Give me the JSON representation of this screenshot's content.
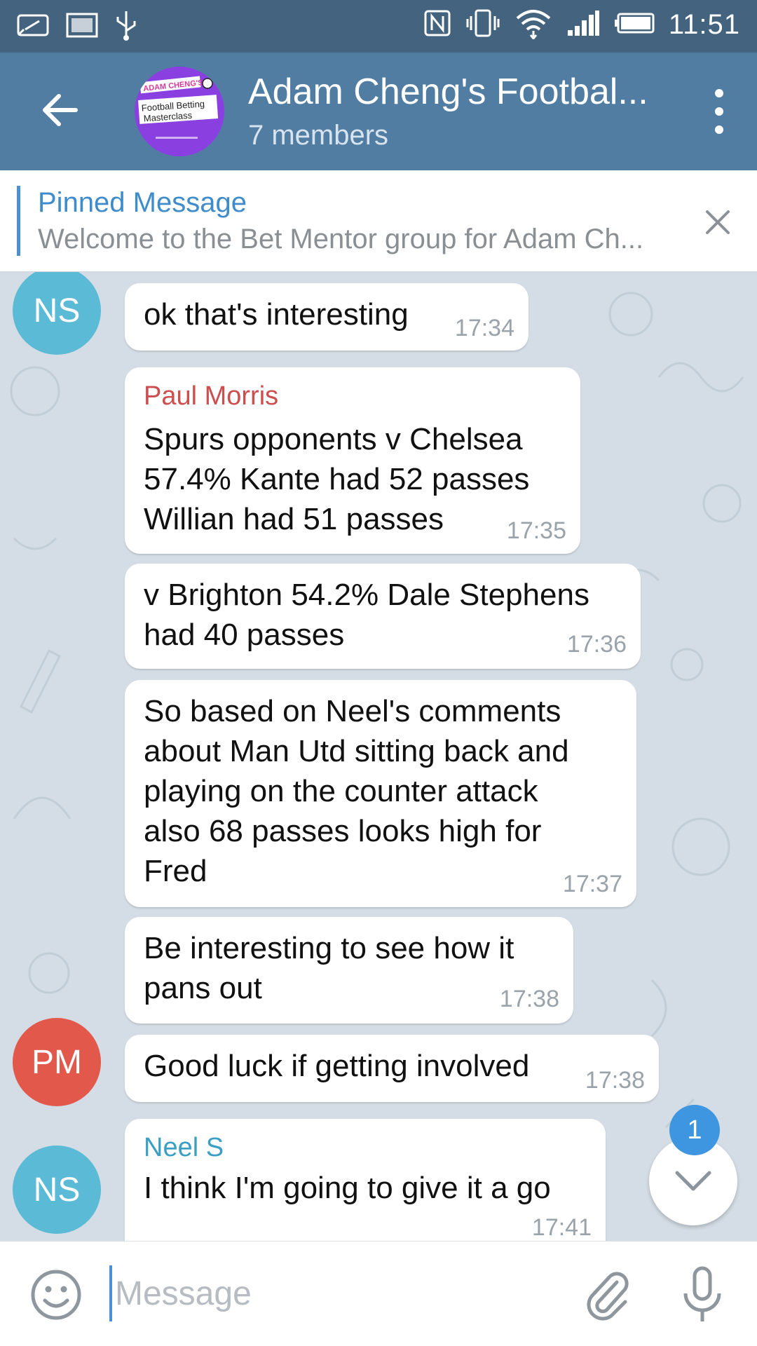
{
  "status_bar": {
    "time": "11:51",
    "left_icons": [
      "messaging-icon",
      "image-icon",
      "usb-icon"
    ],
    "right_icons": [
      "nfc-icon",
      "vibrate-icon",
      "wifi-icon",
      "signal-icon",
      "battery-icon"
    ]
  },
  "header": {
    "title": "Adam Cheng's Footbal...",
    "subtitle": "7 members",
    "avatar_lines": [
      "ADAM CHENG'S",
      "Football Betting",
      "Masterclass"
    ]
  },
  "pinned": {
    "label": "Pinned Message",
    "text": "Welcome to the Bet Mentor group for Adam Ch..."
  },
  "messages": [
    {
      "text": "ok that's interesting",
      "time": "17:34"
    },
    {
      "sender": "Paul Morris",
      "text": "Spurs opponents v Chelsea\n57.4% Kante had 52 passes\nWillian had 51 passes",
      "time": "17:35"
    },
    {
      "text": "v Brighton 54.2% Dale Stephens\nhad 40 passes",
      "time": "17:36"
    },
    {
      "text": "So based on Neel's comments\nabout Man Utd sitting back and\nplaying on the counter attack\nalso 68 passes looks high for\nFred",
      "time": "17:37"
    },
    {
      "text": "Be interesting to see how it\npans out",
      "time": "17:38"
    },
    {
      "text": "Good luck if getting involved",
      "time": "17:38"
    },
    {
      "sender": "Neel S",
      "text": "I think I'm going to give it a go",
      "time": "17:41"
    }
  ],
  "avatars": [
    {
      "initials": "NS",
      "color": "#5bbad5"
    },
    {
      "initials": "PM",
      "color": "#e2594b"
    },
    {
      "initials": "NS",
      "color": "#5bbad5"
    }
  ],
  "sender_colors": {
    "paul": "#cc4e4e",
    "neel": "#3a9fc2"
  },
  "unread_count": "1",
  "input": {
    "placeholder": "Message",
    "value": ""
  }
}
